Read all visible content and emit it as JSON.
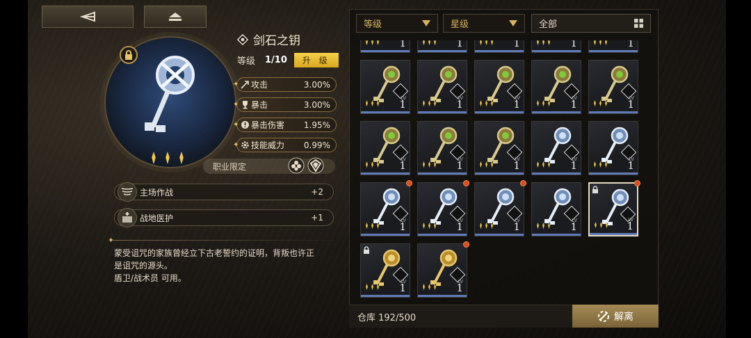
{
  "item": {
    "name": "剑石之钥",
    "level_label": "等级",
    "level_value": "1/10",
    "upgrade_label": "升 级",
    "stars": 3,
    "stats": [
      {
        "name": "攻击",
        "value": "3.00%",
        "icon": "arrow-icon"
      },
      {
        "name": "暴击",
        "value": "3.00%",
        "icon": "trophy-icon"
      },
      {
        "name": "暴击伤害",
        "value": "1.95%",
        "icon": "crit-damage-icon"
      },
      {
        "name": "技能威力",
        "value": "0.99%",
        "icon": "skill-gear-icon"
      }
    ],
    "class_limit_label": "职业限定",
    "skills": [
      {
        "name": "主场作战",
        "value": "+2",
        "icon": "wing-emblem-icon"
      },
      {
        "name": "战地医护",
        "value": "+1",
        "icon": "medic-icon"
      }
    ],
    "description": [
      "蒙受诅咒的家族曾经立下古老誓约的证明，背叛也许正",
      "是诅咒的源头。",
      "盾卫/战术员 可用。"
    ]
  },
  "filters": {
    "level": "等级",
    "star": "星级",
    "category": "全部"
  },
  "inventory": {
    "cells": [
      {
        "type": "green",
        "stars": 3,
        "level": "1",
        "dot": false,
        "lock": false,
        "selected": false
      },
      {
        "type": "green",
        "stars": 3,
        "level": "1",
        "dot": false,
        "lock": false,
        "selected": false
      },
      {
        "type": "green",
        "stars": 3,
        "level": "1",
        "dot": false,
        "lock": false,
        "selected": false
      },
      {
        "type": "green",
        "stars": 3,
        "level": "1",
        "dot": false,
        "lock": false,
        "selected": false
      },
      {
        "type": "green",
        "stars": 3,
        "level": "1",
        "dot": false,
        "lock": false,
        "selected": false
      },
      {
        "type": "green",
        "stars": 3,
        "level": "1",
        "dot": false,
        "lock": false,
        "selected": false
      },
      {
        "type": "green",
        "stars": 3,
        "level": "1",
        "dot": false,
        "lock": false,
        "selected": false
      },
      {
        "type": "green",
        "stars": 3,
        "level": "1",
        "dot": false,
        "lock": false,
        "selected": false
      },
      {
        "type": "blue",
        "stars": 3,
        "level": "1",
        "dot": false,
        "lock": false,
        "selected": false
      },
      {
        "type": "blue",
        "stars": 3,
        "level": "1",
        "dot": false,
        "lock": false,
        "selected": false
      },
      {
        "type": "blue",
        "stars": 3,
        "level": "1",
        "dot": true,
        "lock": false,
        "selected": false
      },
      {
        "type": "blue",
        "stars": 3,
        "level": "1",
        "dot": true,
        "lock": false,
        "selected": false
      },
      {
        "type": "blue",
        "stars": 3,
        "level": "1",
        "dot": true,
        "lock": false,
        "selected": false
      },
      {
        "type": "blue",
        "stars": 3,
        "level": "1",
        "dot": false,
        "lock": false,
        "selected": false
      },
      {
        "type": "blue",
        "stars": 3,
        "level": "1",
        "dot": true,
        "lock": true,
        "selected": true
      },
      {
        "type": "gold",
        "stars": 3,
        "level": "1",
        "dot": false,
        "lock": true,
        "selected": false
      },
      {
        "type": "gold",
        "stars": 3,
        "level": "1",
        "dot": true,
        "lock": false,
        "selected": false
      }
    ],
    "partial_row_level": "1",
    "lv_label": "LV",
    "storage_label": "仓库 192/500",
    "dismantle_label": "解离"
  },
  "colors": {
    "accent_gold": "#d9b45b",
    "upgrade_yellow": "#f2c53a",
    "level_bar": "#5f7bb8",
    "alert_dot": "#e04c16"
  }
}
